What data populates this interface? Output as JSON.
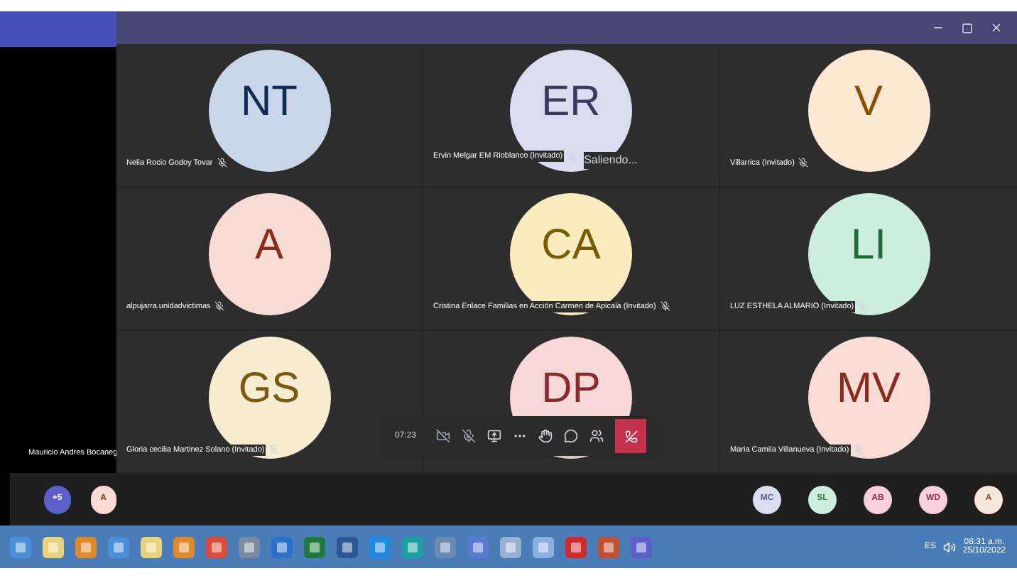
{
  "back_window": {
    "participant_name": "Mauricio Andres Bocaneg",
    "strip_avatars": [
      {
        "initials": "+5",
        "color": "#5b5fc7"
      },
      {
        "initials": "A",
        "color": "#f7dcd6"
      }
    ]
  },
  "tiles": [
    {
      "initials": "NT",
      "name": "Nelia Rocio Godoy Tovar",
      "color": "#c9d6ea"
    },
    {
      "initials": "ER",
      "name": "Ervin Melgar EM Rioblanco (Invitado)",
      "color": "#dcdcf0",
      "status": "Saliendo..."
    },
    {
      "initials": "V",
      "name": "Villarrica (Invitado)",
      "color": "#fde8d3"
    },
    {
      "initials": "A",
      "name": "alpujarra.unidadvictimas",
      "color": "#f7dcd6"
    },
    {
      "initials": "CA",
      "name": "Cristina Enlace Familias en Acción Carmen de Apicalá (Invitado)",
      "color": "#fbecc0"
    },
    {
      "initials": "LI",
      "name": "LUZ ESTHELA ALMARIO (Invitado)",
      "color": "#cdeedd"
    },
    {
      "initials": "GS",
      "name": "Gloria cecilia Martinez Solano (Invitado)",
      "color": "#f8ecd0"
    },
    {
      "initials": "DP",
      "color": "#f6d8d8"
    },
    {
      "initials": "MV",
      "name": "Maria Camila Villanueva (Invitado)",
      "color": "#fadcd6"
    }
  ],
  "call_controls": {
    "timer": "07:23"
  },
  "strip_avatars": [
    {
      "initials": "MC",
      "color": "#dcdcf0"
    },
    {
      "initials": "SL",
      "color": "#cdeedd"
    },
    {
      "initials": "AB",
      "color": "#f6d0dc"
    },
    {
      "initials": "WD",
      "color": "#f6d0dc"
    },
    {
      "initials": "A",
      "color": "#f7e6dc"
    }
  ],
  "taskbar": {
    "language": "ES",
    "time": "08:31 a.m.",
    "date": "25/10/2022"
  }
}
